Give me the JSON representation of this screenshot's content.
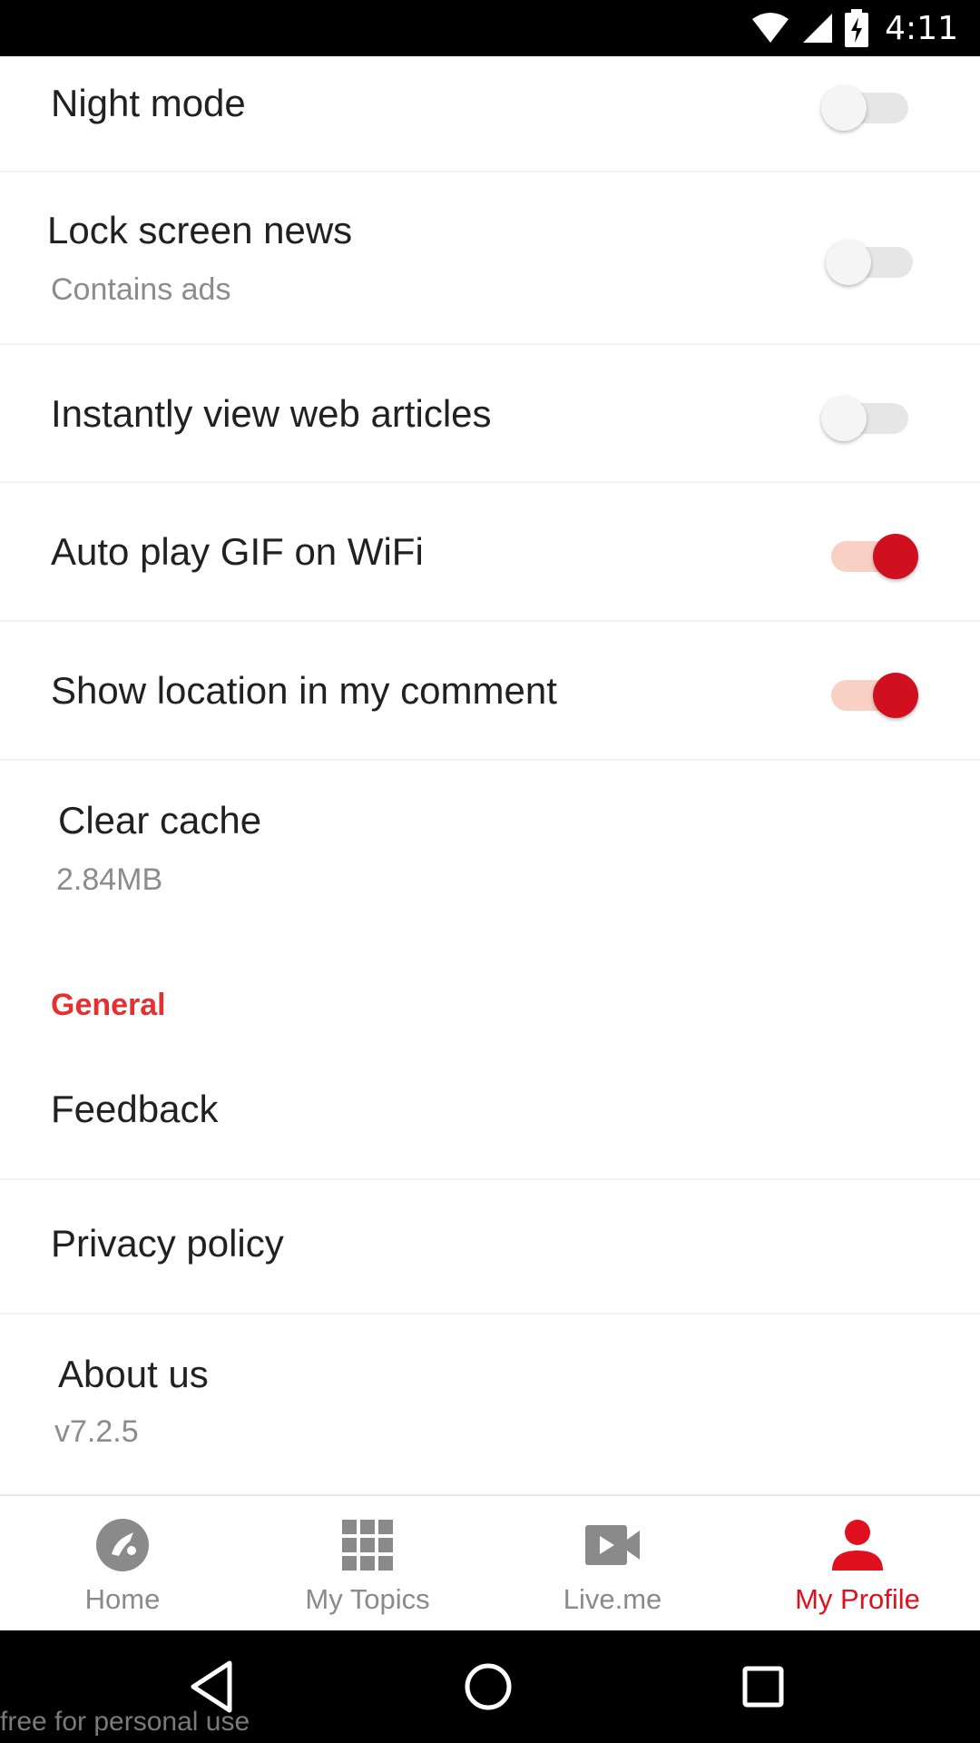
{
  "status_bar": {
    "time": "4:11",
    "icons": [
      "wifi-icon",
      "cell-signal-icon",
      "battery-charging-icon"
    ]
  },
  "settings": {
    "night_mode": {
      "label": "Night mode",
      "enabled": false
    },
    "lock_screen_news": {
      "label": "Lock screen news",
      "subtitle": "Contains ads",
      "enabled": false
    },
    "instant_view": {
      "label": "Instantly view web articles",
      "enabled": false
    },
    "auto_play_gif": {
      "label": "Auto play GIF on WiFi",
      "enabled": true
    },
    "show_location": {
      "label": "Show location in my comment",
      "enabled": true
    },
    "clear_cache": {
      "label": "Clear cache",
      "value": "2.84MB"
    },
    "general_header": "General",
    "feedback": {
      "label": "Feedback"
    },
    "privacy_policy": {
      "label": "Privacy policy"
    },
    "about_us": {
      "label": "About us",
      "version": "v7.2.5"
    }
  },
  "bottom_nav": {
    "items": [
      {
        "label": "Home",
        "icon": "home-icon",
        "active": false
      },
      {
        "label": "My Topics",
        "icon": "grid-icon",
        "active": false
      },
      {
        "label": "Live.me",
        "icon": "video-camera-icon",
        "active": false
      },
      {
        "label": "My Profile",
        "icon": "person-icon",
        "active": true
      }
    ]
  },
  "system_nav": {
    "buttons": [
      "back-icon",
      "home-circle-icon",
      "recents-icon"
    ]
  },
  "watermark": "free for personal use",
  "colors": {
    "accent": "#d0101f",
    "section_header": "#e53030",
    "toggle_on_track": "#f8d0c4",
    "toggle_off_track": "#e6e6e6",
    "nav_inactive": "#8a8a8a"
  }
}
